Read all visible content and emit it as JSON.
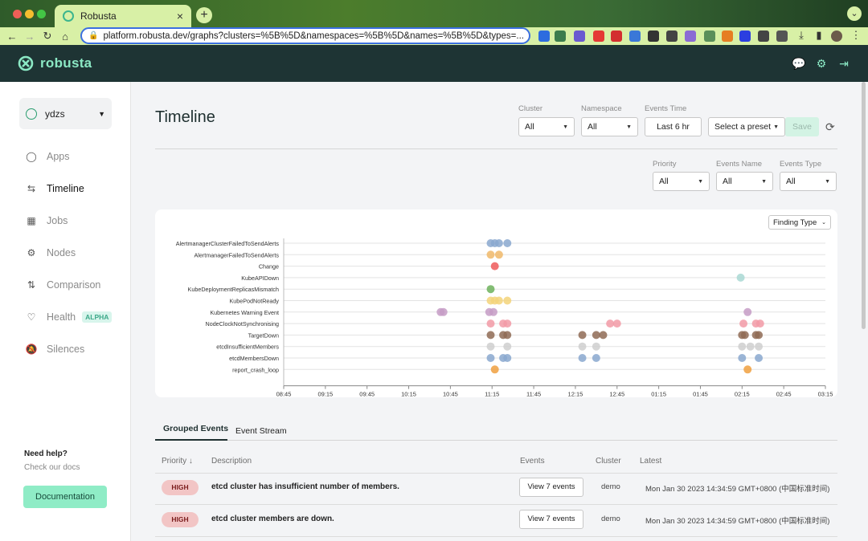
{
  "browser": {
    "tab_title": "Robusta",
    "url": "platform.robusta.dev/graphs?clusters=%5B%5D&namespaces=%5B%5D&names=%5B%5D&types=...",
    "new_tab": "+"
  },
  "app": {
    "brand": "robusta",
    "workspace": "ydzs"
  },
  "sidebar": {
    "items": [
      {
        "label": "Apps",
        "icon": "search-icon"
      },
      {
        "label": "Timeline",
        "icon": "timeline-icon"
      },
      {
        "label": "Jobs",
        "icon": "grid-icon"
      },
      {
        "label": "Nodes",
        "icon": "gear-icon"
      },
      {
        "label": "Comparison",
        "icon": "compare-icon"
      },
      {
        "label": "Health",
        "icon": "stethoscope-icon",
        "badge": "ALPHA"
      },
      {
        "label": "Silences",
        "icon": "bell-off-icon"
      }
    ],
    "help_title": "Need help?",
    "help_sub": "Check our docs",
    "docs_button": "Documentation"
  },
  "page": {
    "title": "Timeline"
  },
  "filters": {
    "cluster": {
      "label": "Cluster",
      "value": "All"
    },
    "namespace": {
      "label": "Namespace",
      "value": "All"
    },
    "events_time": {
      "label": "Events Time",
      "value": "Last 6 hr"
    },
    "preset": {
      "value": "Select a preset"
    },
    "save": "Save",
    "priority": {
      "label": "Priority",
      "value": "All"
    },
    "events_name": {
      "label": "Events Name",
      "value": "All"
    },
    "events_type": {
      "label": "Events Type",
      "value": "All"
    }
  },
  "chart_data": {
    "type": "scatter",
    "finding_type_label": "Finding Type",
    "categories": [
      "AlertmanagerClusterFailedToSendAlerts",
      "AlertmanagerFailedToSendAlerts",
      "Change",
      "KubeAPIDown",
      "KubeDeploymentReplicasMismatch",
      "KubePodNotReady",
      "Kubernetes Warning Event",
      "NodeClockNotSynchronising",
      "TargetDown",
      "etcdInsufficientMembers",
      "etcdMembersDown",
      "report_crash_loop"
    ],
    "x_ticks": [
      "08:45",
      "09:15",
      "09:45",
      "10:15",
      "10:45",
      "11:15",
      "11:45",
      "12:15",
      "12:45",
      "01:15",
      "01:45",
      "02:15",
      "02:45",
      "03:15"
    ],
    "colors": [
      "#8aa8cf",
      "#f0b86a",
      "#ee5a5a",
      "#a9d8d4",
      "#6db25c",
      "#f3d37a",
      "#c69cc6",
      "#f29aa6",
      "#8f6b55",
      "#cfcfcf",
      "#8aa8cf",
      "#f0a040"
    ],
    "series": [
      {
        "category": "AlertmanagerClusterFailedToSendAlerts",
        "x": [
          "11:14",
          "11:17",
          "11:20",
          "11:26"
        ]
      },
      {
        "category": "AlertmanagerFailedToSendAlerts",
        "x": [
          "11:14",
          "11:20"
        ]
      },
      {
        "category": "Change",
        "x": [
          "11:17"
        ]
      },
      {
        "category": "KubeAPIDown",
        "x": [
          "02:14"
        ]
      },
      {
        "category": "KubeDeploymentReplicasMismatch",
        "x": [
          "11:14"
        ]
      },
      {
        "category": "KubePodNotReady",
        "x": [
          "11:14",
          "11:17",
          "11:20",
          "11:26"
        ]
      },
      {
        "category": "Kubernetes Warning Event",
        "x": [
          "10:38",
          "10:40",
          "11:13",
          "11:16",
          "02:19"
        ]
      },
      {
        "category": "NodeClockNotSynchronising",
        "x": [
          "11:14",
          "11:23",
          "11:26",
          "12:40",
          "12:45",
          "02:16",
          "02:25",
          "02:28"
        ]
      },
      {
        "category": "TargetDown",
        "x": [
          "11:14",
          "11:23",
          "11:26",
          "12:20",
          "12:30",
          "12:35",
          "02:15",
          "02:17",
          "02:25",
          "02:27"
        ]
      },
      {
        "category": "etcdInsufficientMembers",
        "x": [
          "11:14",
          "11:26",
          "12:20",
          "12:30",
          "02:15",
          "02:21",
          "02:27"
        ]
      },
      {
        "category": "etcdMembersDown",
        "x": [
          "11:14",
          "11:23",
          "11:26",
          "12:20",
          "12:30",
          "02:15",
          "02:27"
        ]
      },
      {
        "category": "report_crash_loop",
        "x": [
          "11:17",
          "02:19"
        ]
      }
    ]
  },
  "tabs": {
    "grouped": "Grouped Events",
    "stream": "Event Stream"
  },
  "table": {
    "headers": {
      "priority": "Priority",
      "description": "Description",
      "events": "Events",
      "cluster": "Cluster",
      "latest": "Latest"
    },
    "rows": [
      {
        "priority": "HIGH",
        "description": "etcd cluster has insufficient number of members.",
        "events": "View 7 events",
        "cluster": "demo",
        "latest": "Mon Jan 30 2023 14:34:59 GMT+0800 (中国标准时间)"
      },
      {
        "priority": "HIGH",
        "description": "etcd cluster members are down.",
        "events": "View 7 events",
        "cluster": "demo",
        "latest": "Mon Jan 30 2023 14:34:59 GMT+0800 (中国标准时间)"
      }
    ]
  }
}
